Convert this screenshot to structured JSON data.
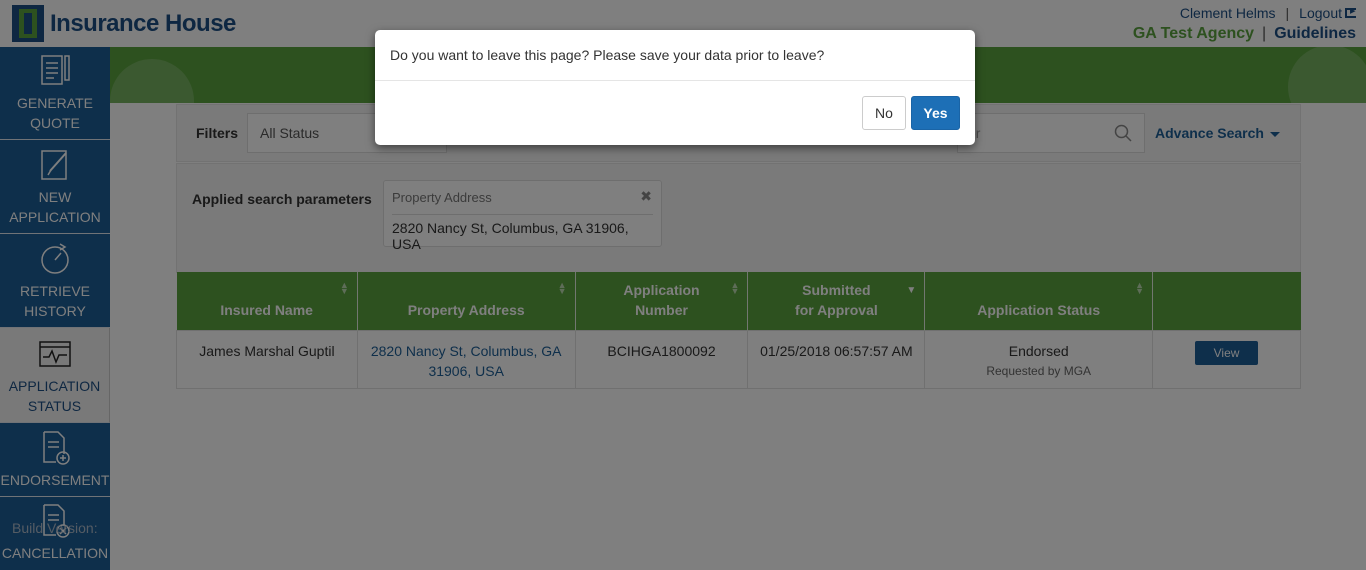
{
  "header": {
    "logo_text": "Insurance House",
    "user_name": "Clement Helms",
    "logout_label": "Logout",
    "agency_name": "GA Test Agency",
    "guidelines_label": "Guidelines",
    "separator": "|"
  },
  "sidebar": {
    "items": [
      {
        "label": "GENERATE QUOTE",
        "icon": "quote-document-icon",
        "active": false
      },
      {
        "label": "NEW APPLICATION",
        "icon": "edit-document-icon",
        "active": false
      },
      {
        "label": "RETRIEVE HISTORY",
        "icon": "history-clock-icon",
        "active": false
      },
      {
        "label": "APPLICATION STATUS",
        "icon": "status-monitor-icon",
        "active": true
      },
      {
        "label": "ENDORSEMENT",
        "icon": "document-plus-icon",
        "active": false
      },
      {
        "label": "CANCELLATION",
        "icon": "document-cancel-icon",
        "active": false
      }
    ],
    "build_version_label": "Build Version:"
  },
  "filters": {
    "label": "Filters",
    "status_value": "All Status",
    "search_placeholder": "er",
    "advance_search_label": "Advance Search"
  },
  "applied_params": {
    "label": "Applied search parameters",
    "param_title": "Property Address",
    "param_value": "2820 Nancy St, Columbus, GA 31906, USA"
  },
  "table": {
    "columns": [
      {
        "line1": "",
        "line2": "Insured Name"
      },
      {
        "line1": "",
        "line2": "Property Address"
      },
      {
        "line1": "Application",
        "line2": "Number"
      },
      {
        "line1": "Submitted",
        "line2": "for Approval"
      },
      {
        "line1": "",
        "line2": "Application Status"
      },
      {
        "line1": "",
        "line2": ""
      }
    ],
    "rows": [
      {
        "insured_name": "James Marshal Guptil",
        "property_address": "2820 Nancy St, Columbus, GA 31906, USA",
        "application_number": "BCIHGA1800092",
        "submitted": "01/25/2018 06:57:57 AM",
        "status": "Endorsed",
        "status_sub": "Requested by MGA",
        "action": "View"
      }
    ]
  },
  "modal": {
    "message": "Do you want to leave this page? Please save your data prior to leave?",
    "no_label": "No",
    "yes_label": "Yes"
  },
  "colors": {
    "brand_blue": "#1d5e96",
    "brand_green": "#5aa23e",
    "primary_button": "#1d6fb6"
  }
}
